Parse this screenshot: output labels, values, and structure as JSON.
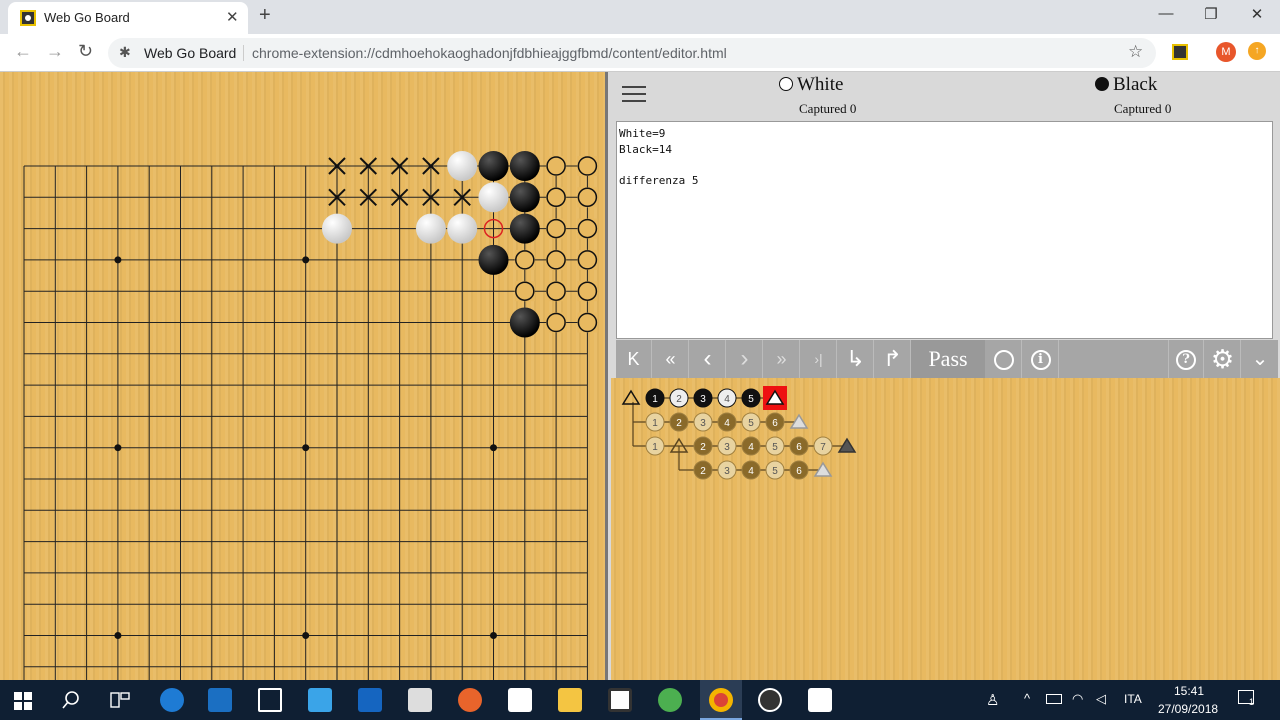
{
  "browser": {
    "tab_title": "Web Go Board",
    "tab_close": "✕",
    "new_tab": "+",
    "site_name": "Web Go Board",
    "url": "chrome-extension://cdmhoehokaoghadonjfdbhieajggfbmd/content/editor.html",
    "profile_initial": "M",
    "minimize": "—",
    "restore": "❐",
    "close": "✕",
    "back": "←",
    "forward": "→",
    "reload": "↻",
    "site_icon": "✱",
    "star": "☆",
    "menu_dot": "↑"
  },
  "players": {
    "white_label": "White",
    "white_captured": "Captured 0",
    "black_label": "Black",
    "black_captured": "Captured 0"
  },
  "comment": {
    "lines": [
      "White=9",
      "Black=14",
      "",
      "differenza 5"
    ]
  },
  "controls": {
    "first": "K",
    "back_many": "«",
    "back": "‹",
    "forward": "›",
    "forward_many": "»",
    "last": "›|",
    "return_var": "↳",
    "goto_var": "↱",
    "pass_label": "Pass",
    "info": "i",
    "help": "?",
    "settings": "⚙",
    "more": "⌄"
  },
  "board": {
    "size": 19,
    "black_stones": [
      [
        15,
        0
      ],
      [
        16,
        0
      ],
      [
        16,
        1
      ],
      [
        16,
        2
      ],
      [
        15,
        3
      ],
      [
        16,
        5
      ]
    ],
    "white_stones": [
      [
        14,
        0
      ],
      [
        15,
        1
      ],
      [
        10,
        2
      ],
      [
        13,
        2
      ],
      [
        14,
        2
      ]
    ],
    "last_move_marker": [
      15,
      2
    ],
    "x_marks": [
      [
        10,
        0
      ],
      [
        11,
        0
      ],
      [
        12,
        0
      ],
      [
        13,
        0
      ],
      [
        10,
        1
      ],
      [
        11,
        1
      ],
      [
        12,
        1
      ],
      [
        13,
        1
      ],
      [
        14,
        1
      ]
    ],
    "circle_marks": [
      [
        17,
        0
      ],
      [
        18,
        0
      ],
      [
        17,
        1
      ],
      [
        18,
        1
      ],
      [
        17,
        2
      ],
      [
        18,
        2
      ],
      [
        16,
        3
      ],
      [
        17,
        3
      ],
      [
        18,
        3
      ],
      [
        16,
        4
      ],
      [
        17,
        4
      ],
      [
        18,
        4
      ],
      [
        17,
        5
      ],
      [
        18,
        5
      ]
    ],
    "hoshi": [
      [
        3,
        3
      ],
      [
        9,
        3
      ],
      [
        15,
        3
      ],
      [
        3,
        9
      ],
      [
        9,
        9
      ],
      [
        15,
        9
      ],
      [
        3,
        15
      ],
      [
        9,
        15
      ],
      [
        15,
        15
      ]
    ]
  },
  "tree": {
    "rows": [
      {
        "row": 0,
        "start": 1,
        "nodes": [
          {
            "label": "1",
            "c": "b"
          },
          {
            "label": "2",
            "c": "w"
          },
          {
            "label": "3",
            "c": "b"
          },
          {
            "label": "4",
            "c": "w"
          },
          {
            "label": "5",
            "c": "b"
          },
          {
            "label": "",
            "c": "current"
          }
        ]
      },
      {
        "row": 1,
        "start": 1,
        "nodes": [
          {
            "label": "1",
            "c": "w"
          },
          {
            "label": "2",
            "c": "b"
          },
          {
            "label": "3",
            "c": "w"
          },
          {
            "label": "4",
            "c": "b"
          },
          {
            "label": "5",
            "c": "w"
          },
          {
            "label": "6",
            "c": "b"
          },
          {
            "label": "",
            "c": "tri"
          }
        ]
      },
      {
        "row": 2,
        "start": 1,
        "nodes": [
          {
            "label": "1",
            "c": "w"
          },
          {
            "label": "",
            "c": "triopen"
          },
          {
            "label": "2",
            "c": "b"
          },
          {
            "label": "3",
            "c": "w"
          },
          {
            "label": "4",
            "c": "b"
          },
          {
            "label": "5",
            "c": "w"
          },
          {
            "label": "6",
            "c": "b"
          },
          {
            "label": "7",
            "c": "w"
          },
          {
            "label": "",
            "c": "tridark"
          }
        ]
      },
      {
        "row": 3,
        "start": 3,
        "nodes": [
          {
            "label": "2",
            "c": "b"
          },
          {
            "label": "3",
            "c": "w"
          },
          {
            "label": "4",
            "c": "b"
          },
          {
            "label": "5",
            "c": "w"
          },
          {
            "label": "6",
            "c": "b"
          },
          {
            "label": "",
            "c": "tri"
          }
        ]
      }
    ]
  },
  "taskbar": {
    "language": "ITA",
    "time": "15:41",
    "date": "27/09/2018",
    "notifications": "1",
    "up_arrow": "^"
  }
}
